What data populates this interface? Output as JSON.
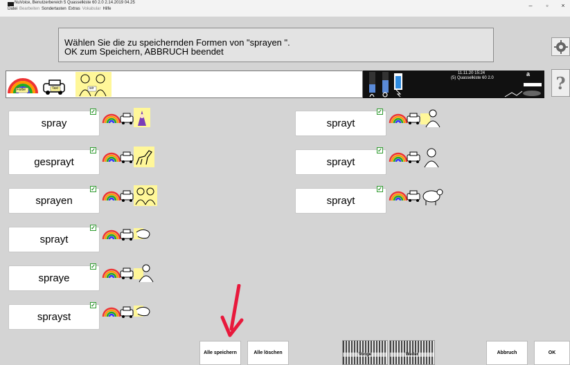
{
  "window": {
    "title": "NuVoice, Benutzerbereich 5   Quasselkiste 60 2.0   2.14.2019 04.25",
    "controls": {
      "minimize": "–",
      "maximize": "▫",
      "close": "×"
    }
  },
  "menu": [
    {
      "label": "Datei",
      "dim": false
    },
    {
      "label": "Bearbeiten",
      "dim": true
    },
    {
      "label": "Sondertasten",
      "dim": false
    },
    {
      "label": "Extras",
      "dim": false
    },
    {
      "label": "Vokabular",
      "dim": true
    },
    {
      "label": "Hilfe",
      "dim": false
    }
  ],
  "instruction": {
    "line1": "Wählen Sie die zu speichernden Formen von \"sprayen \".",
    "line2": "OK zum Speichern, ABBRUCH beendet"
  },
  "symbol_bar": {
    "labels": [
      "Farbe",
      "Taxi",
      "wir"
    ]
  },
  "status": {
    "date": "11.11.20 15:24",
    "profile": "(5) Quasselkiste 60 2.0",
    "letter": "a"
  },
  "side_buttons": {
    "help": "?"
  },
  "forms_left": [
    {
      "word": "spray",
      "checked": true,
      "picture": "wizard-icon"
    },
    {
      "word": "gesprayt",
      "checked": true,
      "picture": "dinosaur-icon"
    },
    {
      "word": "sprayen",
      "checked": true,
      "picture": "people-icon"
    },
    {
      "word": "sprayt",
      "checked": true,
      "picture": "hand-icon"
    },
    {
      "word": "spraye",
      "checked": true,
      "picture": "person-icon"
    },
    {
      "word": "sprayst",
      "checked": true,
      "picture": "hand-icon"
    }
  ],
  "forms_right": [
    {
      "word": "sprayt",
      "checked": true,
      "picture": "person-icon"
    },
    {
      "word": "sprayt",
      "checked": true,
      "picture": "woman-icon"
    },
    {
      "word": "sprayt",
      "checked": true,
      "picture": "sheep-icon"
    }
  ],
  "buttons": {
    "save_all": "Alle speichern",
    "delete_all": "Alle löschen",
    "prev": "Vorige",
    "next": "Weiter",
    "cancel": "Abbruch",
    "ok": "OK"
  },
  "colors": {
    "accent_arrow": "#e8193c",
    "check": "#1e8a1e",
    "highlight": "#fff799"
  }
}
